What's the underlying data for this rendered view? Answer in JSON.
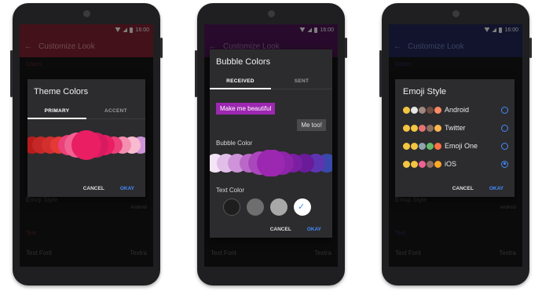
{
  "status": {
    "time": "16:00"
  },
  "appbar": {
    "title": "Customize Look"
  },
  "background": {
    "section_colors": "Colors",
    "section_text": "Text",
    "emoji_style_label": "Emoji Style",
    "emoji_style_value": "Android",
    "text_font_label": "Text Font",
    "text_font_value": "Textra"
  },
  "theme_dialog": {
    "title": "Theme Colors",
    "tabs": [
      "PRIMARY",
      "ACCENT"
    ],
    "swatches": [
      "#b71c1c",
      "#c62828",
      "#d32f2f",
      "#e53935",
      "#ec407a",
      "#f06292",
      "#e91e63",
      "#d81b60",
      "#e91e63",
      "#ec407a",
      "#f48fb1",
      "#f8bbd0",
      "#ce93d8"
    ],
    "cancel": "CANCEL",
    "ok": "OKAY"
  },
  "bubble_dialog": {
    "title": "Bubble Colors",
    "tabs": [
      "RECEIVED",
      "SENT"
    ],
    "message_received": "Make me beautiful",
    "message_sent": "Me too!",
    "bubble_color_label": "Bubble Color",
    "swatches": [
      "#f3e5f5",
      "#e1bee7",
      "#ce93d8",
      "#ba68c8",
      "#ab47bc",
      "#9c27b0",
      "#8e24aa",
      "#7b1fa2",
      "#6a1b9a",
      "#5e35b1",
      "#3949ab"
    ],
    "text_color_label": "Text Color",
    "text_colors": [
      "#1e1e1e",
      "#6e6e6e",
      "#a8a8a8",
      "#ffffff"
    ],
    "cancel": "CANCEL",
    "ok": "OKAY"
  },
  "emoji_dialog": {
    "title": "Emoji Style",
    "options": [
      {
        "label": "Android",
        "selected": false
      },
      {
        "label": "Twitter",
        "selected": false
      },
      {
        "label": "Emoji One",
        "selected": false
      },
      {
        "label": "iOS",
        "selected": true
      }
    ],
    "cancel": "CANCEL",
    "ok": "OKAY"
  },
  "colors": {
    "accent": "#448aff",
    "theme1_appbar": "#7a1f2f",
    "theme2_appbar": "#4a1550",
    "theme3_appbar": "#1f2550",
    "bubble_received": "#9c27b0"
  }
}
